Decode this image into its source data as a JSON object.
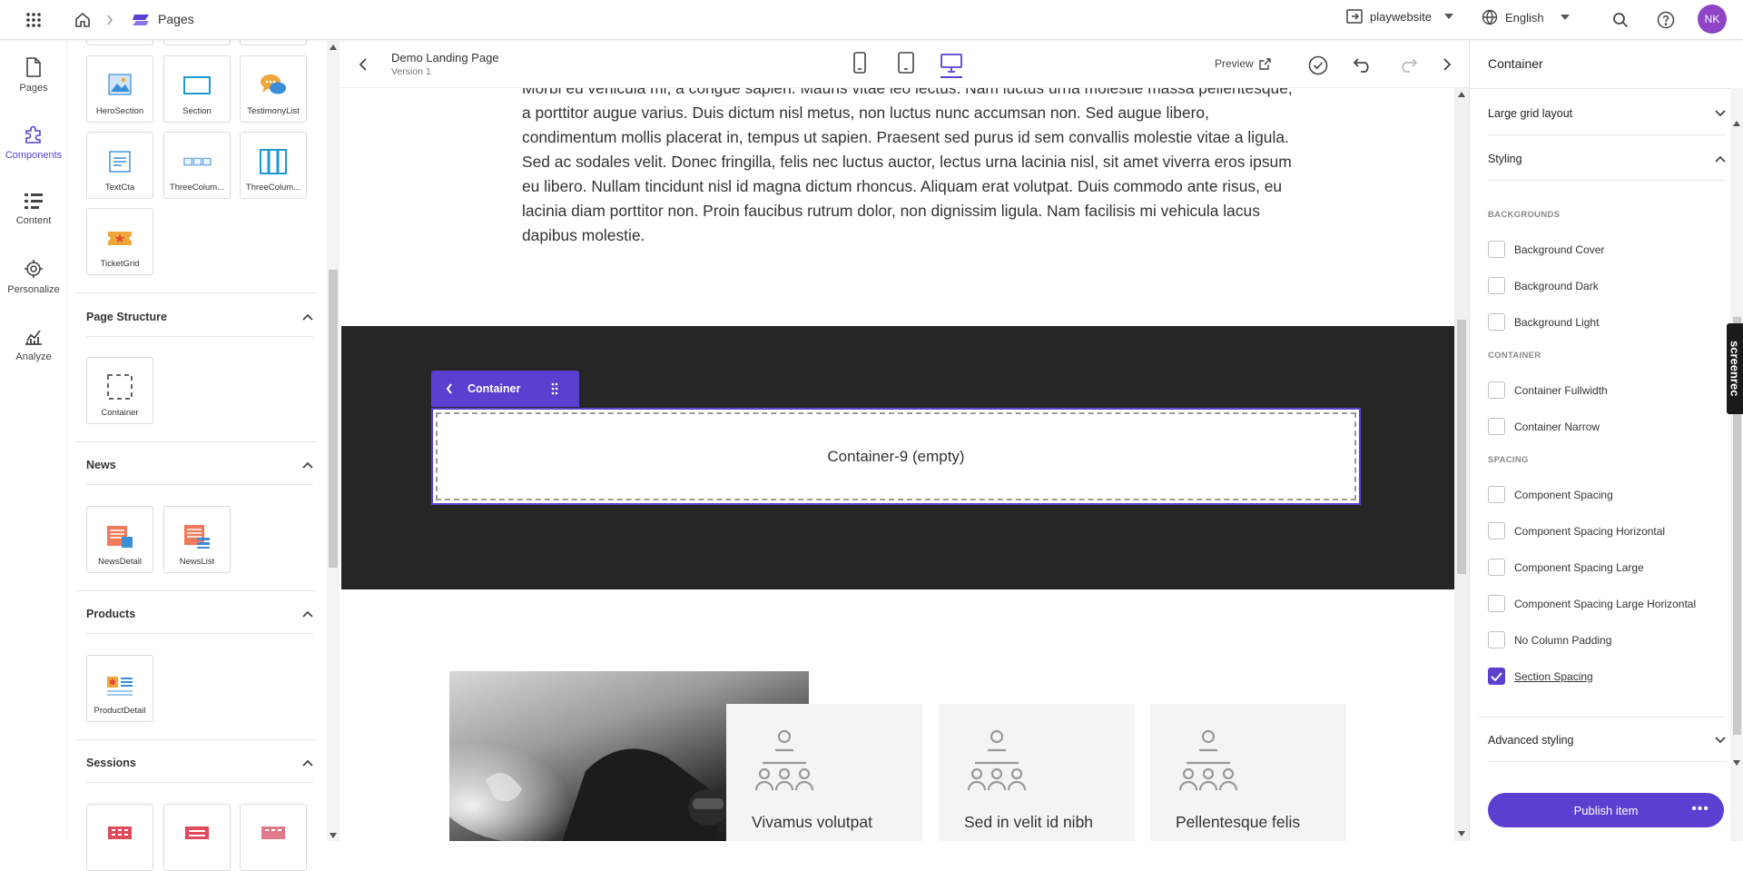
{
  "topbar": {
    "breadcrumb_current": "Pages",
    "site": "playwebsite",
    "language": "English",
    "user_initials": "NK"
  },
  "rail": {
    "items": [
      {
        "label": "Pages",
        "icon": "page-icon"
      },
      {
        "label": "Components",
        "icon": "puzzle-icon"
      },
      {
        "label": "Content",
        "icon": "list-icon"
      },
      {
        "label": "Personalize",
        "icon": "target-icon"
      },
      {
        "label": "Analyze",
        "icon": "chart-icon"
      }
    ],
    "active": "Components"
  },
  "panel": {
    "tiles_top": [
      {
        "label": "HeroSection",
        "icon": "hero-section-icon"
      },
      {
        "label": "Section",
        "icon": "section-icon"
      },
      {
        "label": "TestimonyList",
        "icon": "testimony-icon"
      },
      {
        "label": "TextCta",
        "icon": "text-cta-icon"
      },
      {
        "label": "ThreeColum...",
        "icon": "three-column-icon"
      },
      {
        "label": "ThreeColum...",
        "icon": "three-column-alt-icon"
      },
      {
        "label": "TicketGrid",
        "icon": "ticket-icon"
      }
    ],
    "sections": [
      {
        "title": "Page Structure",
        "tiles": [
          {
            "label": "Container",
            "icon": "container-icon"
          }
        ]
      },
      {
        "title": "News",
        "tiles": [
          {
            "label": "NewsDetail",
            "icon": "news-detail-icon"
          },
          {
            "label": "NewsList",
            "icon": "news-list-icon"
          }
        ]
      },
      {
        "title": "Products",
        "tiles": [
          {
            "label": "ProductDetail",
            "icon": "product-detail-icon"
          }
        ]
      },
      {
        "title": "Sessions",
        "tiles": []
      }
    ]
  },
  "editor": {
    "page_name": "Demo Landing Page",
    "version": "Version 1",
    "preview_label": "Preview",
    "lorem": "Morbi eu vehicula mi, a congue sapien. Mauris vitae leo lectus. Nam luctus urna molestie massa pellentesque, a porttitor augue varius. Duis dictum nisl metus, non luctus nunc accumsan non. Sed augue libero, condimentum mollis placerat in, tempus ut sapien. Praesent sed purus id sem convallis molestie vitae a ligula. Sed ac sodales velit. Donec fringilla, felis nec luctus auctor, lectus urna lacinia nisl, sit amet viverra eros ipsum eu libero. Nullam tincidunt nisl id magna dictum rhoncus. Aliquam erat volutpat. Duis commodo ante risus, eu lacinia diam porttitor non. Proin faucibus rutrum dolor, non dignissim ligula. Nam facilisis mi vehicula lacus dapibus molestie.",
    "container_tab": "Container",
    "container_placeholder": "Container-9 (empty)",
    "cards": [
      {
        "title": "Vivamus volutpat"
      },
      {
        "title": "Sed in velit id nibh"
      },
      {
        "title": "Pellentesque felis"
      }
    ]
  },
  "inspector": {
    "title": "Container",
    "accordions": {
      "large_grid": "Large grid layout",
      "styling": "Styling",
      "advanced": "Advanced styling"
    },
    "groups": {
      "backgrounds": "BACKGROUNDS",
      "container": "CONTAINER",
      "spacing": "SPACING"
    },
    "options": [
      {
        "label": "Background Cover",
        "checked": false
      },
      {
        "label": "Background Dark",
        "checked": false
      },
      {
        "label": "Background Light",
        "checked": false
      },
      {
        "label": "Container Fullwidth",
        "checked": false
      },
      {
        "label": "Container Narrow",
        "checked": false
      },
      {
        "label": "Component Spacing",
        "checked": false
      },
      {
        "label": "Component Spacing Horizontal",
        "checked": false
      },
      {
        "label": "Component Spacing Large",
        "checked": false
      },
      {
        "label": "Component Spacing Large Horizontal",
        "checked": false
      },
      {
        "label": "No Column Padding",
        "checked": false
      },
      {
        "label": "Section Spacing",
        "checked": true
      }
    ],
    "publish_label": "Publish item",
    "publish_more": "•••"
  },
  "overlay": {
    "recorder_label": "screenrec"
  },
  "colors": {
    "accent": "#5a3fd1",
    "avatar": "#8e44c5",
    "dark_band": "#262626"
  }
}
